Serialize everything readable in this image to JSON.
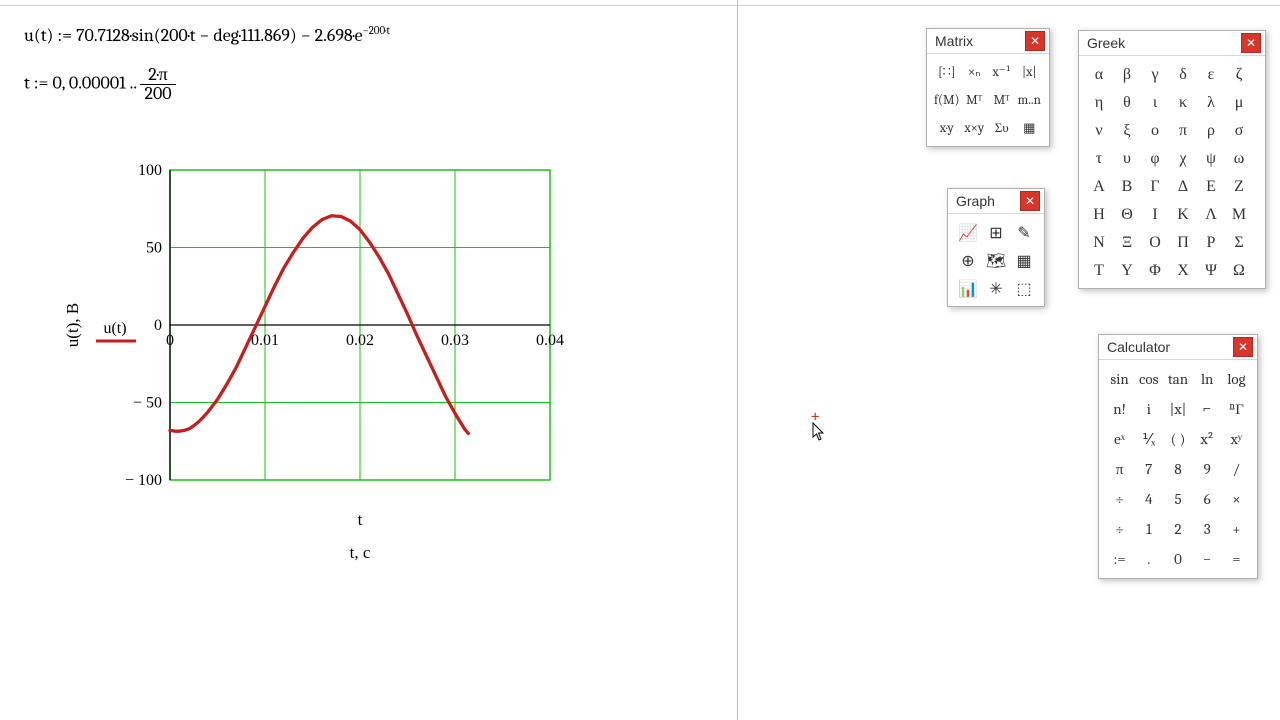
{
  "equations": {
    "line1_html": "u(t) := 70.7128·sin(200·t − deg·111.869) − 2.698·e<sup>−200·t</sup>",
    "line2_prefix": "t := 0, 0.00001 .. ",
    "line2_frac_num": "2·π",
    "line2_frac_den": "200"
  },
  "chart": {
    "y_label": "u(t), B",
    "x_label": "t",
    "x_label2": "t, c",
    "series_name": "u(t)",
    "y_ticks": [
      -100,
      -50,
      0,
      50,
      100
    ],
    "x_ticks": [
      0,
      0.01,
      0.02,
      0.03,
      0.04
    ]
  },
  "chart_data": {
    "type": "line",
    "title": "",
    "xlabel": "t, c",
    "ylabel": "u(t), B",
    "xlim": [
      0,
      0.04
    ],
    "ylim": [
      -100,
      100
    ],
    "series": [
      {
        "name": "u(t)",
        "color": "#c41e1e",
        "x": [
          0.0,
          0.0005,
          0.001,
          0.0015,
          0.002,
          0.0025,
          0.003,
          0.0035,
          0.004,
          0.005,
          0.006,
          0.007,
          0.008,
          0.009,
          0.01,
          0.011,
          0.012,
          0.013,
          0.014,
          0.015,
          0.016,
          0.017,
          0.018,
          0.019,
          0.02,
          0.021,
          0.022,
          0.023,
          0.024,
          0.025,
          0.026,
          0.027,
          0.028,
          0.029,
          0.03,
          0.031,
          0.0314
        ],
        "y": [
          -68,
          -68.5,
          -68.5,
          -68,
          -67,
          -65,
          -62.5,
          -59.5,
          -56,
          -48,
          -38,
          -27,
          -14,
          -1,
          12,
          25,
          37,
          47,
          56,
          63,
          68,
          70.5,
          70,
          67,
          61.5,
          53.5,
          44,
          33,
          20,
          7,
          -7,
          -20,
          -33,
          -46,
          -57,
          -67,
          -70
        ]
      }
    ]
  },
  "panels": {
    "matrix": {
      "title": "Matrix",
      "rows": [
        [
          "[∷]",
          "×ₙ",
          "x⁻¹",
          "|x|"
        ],
        [
          "f(M)",
          "Mᵀ",
          "Mᵀ",
          "m..n"
        ],
        [
          "x·y",
          "x×y",
          "Συ",
          "▦"
        ]
      ]
    },
    "greek": {
      "title": "Greek",
      "rows": [
        [
          "α",
          "β",
          "γ",
          "δ",
          "ε",
          "ζ"
        ],
        [
          "η",
          "θ",
          "ι",
          "κ",
          "λ",
          "μ"
        ],
        [
          "ν",
          "ξ",
          "ο",
          "π",
          "ρ",
          "σ"
        ],
        [
          "τ",
          "υ",
          "φ",
          "χ",
          "ψ",
          "ω"
        ],
        [
          "Α",
          "Β",
          "Γ",
          "Δ",
          "Ε",
          "Ζ"
        ],
        [
          "Η",
          "Θ",
          "Ι",
          "Κ",
          "Λ",
          "Μ"
        ],
        [
          "Ν",
          "Ξ",
          "Ο",
          "Π",
          "Ρ",
          "Σ"
        ],
        [
          "Τ",
          "Υ",
          "Φ",
          "Χ",
          "Ψ",
          "Ω"
        ]
      ]
    },
    "graph": {
      "title": "Graph",
      "rows": [
        [
          "📈",
          "⊞",
          "✎"
        ],
        [
          "⊕",
          "🗺",
          "▦"
        ],
        [
          "📊",
          "✳",
          "⬚"
        ]
      ]
    },
    "calculator": {
      "title": "Calculator",
      "rows": [
        [
          "sin",
          "cos",
          "tan",
          "ln",
          "log"
        ],
        [
          "n!",
          "i",
          "|x|",
          "⌐",
          "ⁿΓ"
        ],
        [
          "eˣ",
          "⅟ₓ",
          "( )",
          "x²",
          "xʸ"
        ],
        [
          "π",
          "7",
          "8",
          "9",
          "/"
        ],
        [
          "÷",
          "4",
          "5",
          "6",
          "×"
        ],
        [
          "÷",
          "1",
          "2",
          "3",
          "+"
        ],
        [
          ":=",
          ".",
          "0",
          "−",
          "="
        ]
      ]
    }
  },
  "cursor": {
    "glyph": "+"
  }
}
